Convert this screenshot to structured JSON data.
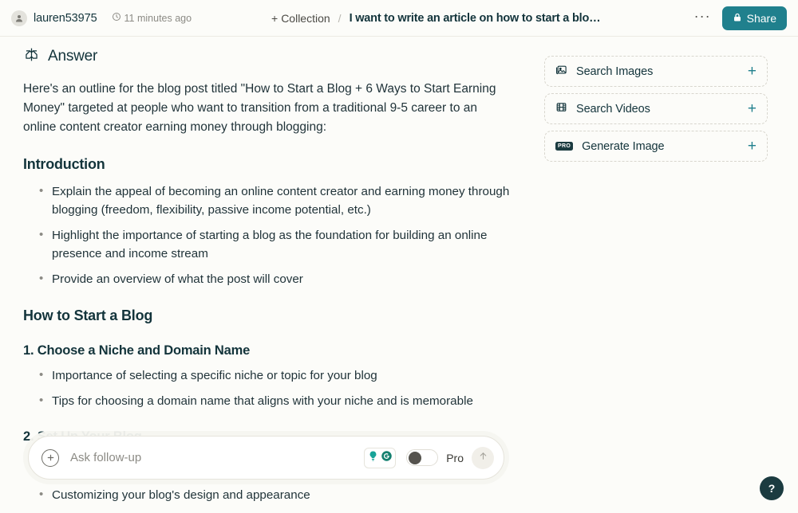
{
  "header": {
    "username": "lauren53975",
    "avatar_icon": "user-avatar-icon",
    "clock_icon": "clock-icon",
    "timestamp": "11 minutes ago",
    "collection_label": "Collection",
    "collection_plus": "+",
    "separator": "/",
    "thread_title": "I want to write an article on how to start a blo…",
    "more_label": "···",
    "share_label": "Share",
    "share_icon": "lock-icon",
    "share_color": "#20808D"
  },
  "answer": {
    "icon": "perplexity-logo-icon",
    "title": "Answer",
    "intro": "Here's an outline for the blog post titled \"How to Start a Blog + 6 Ways to Start Earning Money\" targeted at people who want to transition from a traditional 9-5 career to an online content creator earning money through blogging:",
    "sections": [
      {
        "heading": "Introduction",
        "bullets": [
          "Explain the appeal of becoming an online content creator and earning money through blogging (freedom, flexibility, passive income potential, etc.)",
          "Highlight the importance of starting a blog as the foundation for building an online presence and income stream",
          "Provide an overview of what the post will cover"
        ]
      },
      {
        "heading": "How to Start a Blog",
        "bullets": []
      },
      {
        "heading": "1. Choose a Niche and Domain Name",
        "bullets": [
          "Importance of selecting a specific niche or topic for your blog",
          "Tips for choosing a domain name that aligns with your niche and is memorable"
        ]
      },
      {
        "heading": "2. Set Up Your Blog",
        "bullets": [
          "Customizing your blog's design and appearance"
        ]
      }
    ]
  },
  "sidebar": {
    "cards": [
      {
        "label": "Search Images",
        "icon": "image-icon",
        "action": "+",
        "pro": false
      },
      {
        "label": "Search Videos",
        "icon": "film-icon",
        "action": "+",
        "pro": false
      },
      {
        "label": "Generate Image",
        "icon": "pro-badge-icon",
        "action": "+",
        "pro": true,
        "pro_text": "PRO"
      }
    ]
  },
  "followup": {
    "plus_icon": "plus-circle-icon",
    "placeholder": "Ask follow-up",
    "value": "",
    "extension_icons": [
      {
        "name": "lightbulb-icon",
        "color": "#17A398"
      },
      {
        "name": "grammarly-g-icon",
        "color": "#15806F"
      }
    ],
    "toggle_state": "off",
    "pro_label": "Pro",
    "send_icon": "arrow-up-icon"
  },
  "help": {
    "label": "?",
    "icon": "question-mark-icon"
  }
}
